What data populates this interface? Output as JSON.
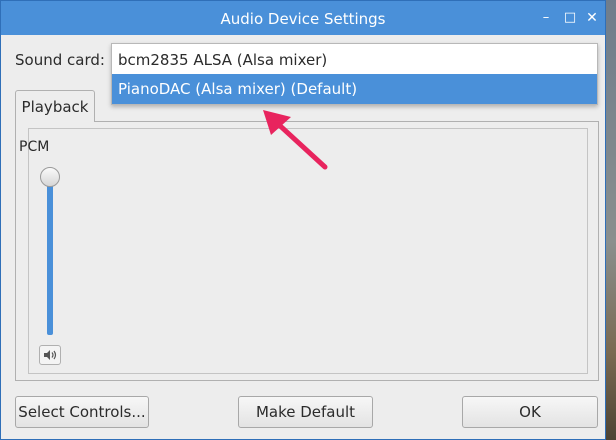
{
  "window": {
    "title": "Audio Device Settings",
    "minimize_glyph": "–",
    "maximize_glyph": "□",
    "close_glyph": "✕"
  },
  "sound_card": {
    "label": "Sound card:",
    "options": [
      "bcm2835 ALSA (Alsa mixer)",
      "PianoDAC (Alsa mixer) (Default)"
    ],
    "highlighted": "PianoDAC (Alsa mixer) (Default)"
  },
  "tabs": [
    {
      "label": "Playback",
      "active": true
    }
  ],
  "playback": {
    "channel_label": "PCM",
    "volume_level": 1.0,
    "mute_icon": "speaker-icon"
  },
  "buttons": {
    "select_controls": "Select Controls...",
    "make_default": "Make Default",
    "ok": "OK"
  },
  "colors": {
    "accent": "#4a90d9",
    "annotation_arrow": "#e8245e"
  }
}
